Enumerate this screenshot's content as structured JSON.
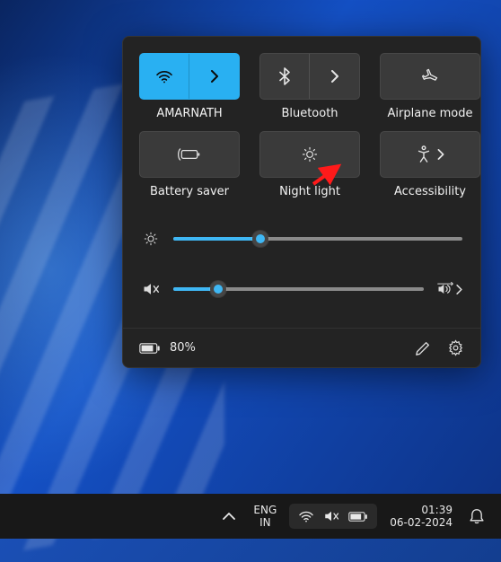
{
  "quick_settings": {
    "tiles": {
      "wifi": {
        "label": "AMARNATH",
        "active": true
      },
      "bluetooth": {
        "label": "Bluetooth",
        "active": false
      },
      "airplane": {
        "label": "Airplane mode",
        "active": false
      },
      "battery_saver": {
        "label": "Battery saver",
        "active": false
      },
      "night_light": {
        "label": "Night light",
        "active": false
      },
      "accessibility": {
        "label": "Accessibility",
        "active": false
      }
    },
    "brightness": {
      "value": 30
    },
    "volume": {
      "value": 18,
      "muted": true
    },
    "footer": {
      "battery_text": "80%"
    }
  },
  "taskbar": {
    "lang_top": "ENG",
    "lang_bottom": "IN",
    "time": "01:39",
    "date": "06-02-2024"
  }
}
